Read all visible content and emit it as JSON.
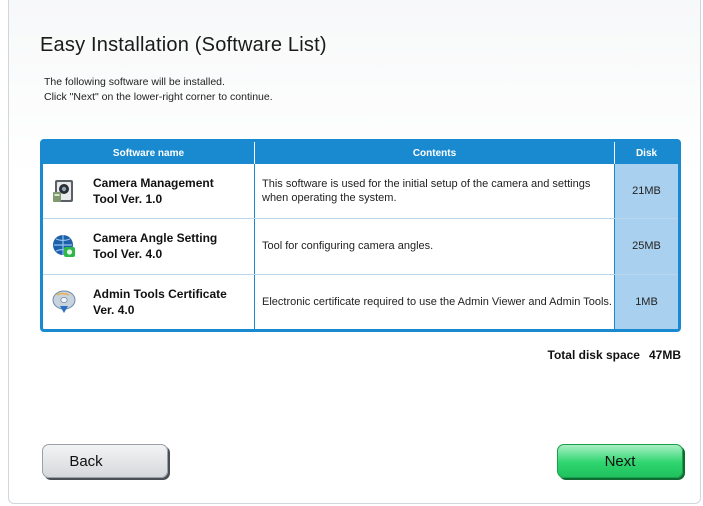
{
  "page": {
    "title": "Easy Installation (Software List)",
    "instructions": [
      "The following software will be installed.",
      "Click \"Next\" on the lower-right corner to continue."
    ]
  },
  "table": {
    "headers": {
      "name": "Software name",
      "contents": "Contents",
      "disk": "Disk"
    },
    "rows": [
      {
        "icon": "camera-management-icon",
        "name_line1": "Camera Management",
        "name_line2": "Tool Ver. 1.0",
        "contents": "This software is used for the initial setup of the camera and settings when operating the system.",
        "disk": "21MB"
      },
      {
        "icon": "camera-angle-globe-icon",
        "name_line1": "Camera Angle Setting",
        "name_line2": "Tool Ver. 4.0",
        "contents": "Tool for configuring camera angles.",
        "disk": "25MB"
      },
      {
        "icon": "certificate-disc-icon",
        "name_line1": "Admin Tools Certificate",
        "name_line2": "Ver. 4.0",
        "contents": "Electronic certificate required to use the Admin Viewer and Admin Tools.",
        "disk": "1MB"
      }
    ]
  },
  "total": {
    "label": "Total disk space",
    "value": "47MB"
  },
  "buttons": {
    "back": "Back",
    "next": "Next"
  },
  "colors": {
    "accent": "#1a8ad0",
    "disk_column": "#a9d1ef",
    "next_button": "#2fd56f"
  }
}
